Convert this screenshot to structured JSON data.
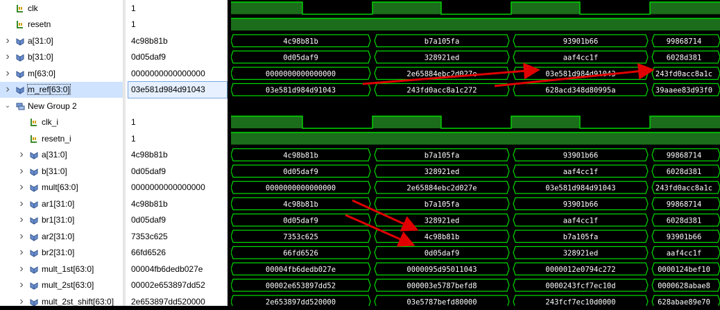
{
  "signals": [
    {
      "name": "clk",
      "value": "1",
      "kind": "bit",
      "indent": 0,
      "expand": ""
    },
    {
      "name": "resetn",
      "value": "1",
      "kind": "bit",
      "indent": 0,
      "expand": ""
    },
    {
      "name": "a[31:0]",
      "value": "4c98b81b",
      "kind": "bus",
      "indent": 0,
      "expand": ">",
      "segments": [
        "4c98b81b",
        "b7a105fa",
        "93901b66",
        "99868714"
      ]
    },
    {
      "name": "b[31:0]",
      "value": "0d05daf9",
      "kind": "bus",
      "indent": 0,
      "expand": ">",
      "segments": [
        "0d05daf9",
        "328921ed",
        "aaf4cc1f",
        "6028d381"
      ]
    },
    {
      "name": "m[63:0]",
      "value": "0000000000000000",
      "kind": "bus",
      "indent": 0,
      "expand": ">",
      "segments": [
        "0000000000000000",
        "2e65884ebc2d027e",
        "03e581d984d91043",
        "243fd0acc8a1c"
      ]
    },
    {
      "name": "m_ref[63:0]",
      "value": "03e581d984d91043",
      "kind": "bus",
      "indent": 0,
      "expand": ">",
      "selected": true,
      "segments": [
        "03e581d984d91043",
        "243fd0acc8a1c272",
        "628acd348d80995a",
        "39aaee83d93f0"
      ]
    },
    {
      "name": "New Group 2",
      "value": "",
      "kind": "group",
      "indent": 0,
      "expand": "v"
    },
    {
      "name": "clk_i",
      "value": "1",
      "kind": "bit",
      "indent": 1,
      "expand": ""
    },
    {
      "name": "resetn_i",
      "value": "1",
      "kind": "bit",
      "indent": 1,
      "expand": ""
    },
    {
      "name": "a[31:0]",
      "value": "4c98b81b",
      "kind": "bus",
      "indent": 1,
      "expand": ">",
      "segments": [
        "4c98b81b",
        "b7a105fa",
        "93901b66",
        "99868714"
      ]
    },
    {
      "name": "b[31:0]",
      "value": "0d05daf9",
      "kind": "bus",
      "indent": 1,
      "expand": ">",
      "segments": [
        "0d05daf9",
        "328921ed",
        "aaf4cc1f",
        "6028d381"
      ]
    },
    {
      "name": "mult[63:0]",
      "value": "0000000000000000",
      "kind": "bus",
      "indent": 1,
      "expand": ">",
      "segments": [
        "0000000000000000",
        "2e65884ebc2d027e",
        "03e581d984d91043",
        "243fd0acc8a1c"
      ]
    },
    {
      "name": "ar1[31:0]",
      "value": "4c98b81b",
      "kind": "bus",
      "indent": 1,
      "expand": ">",
      "segments": [
        "4c98b81b",
        "b7a105fa",
        "93901b66",
        "99868714"
      ]
    },
    {
      "name": "br1[31:0]",
      "value": "0d05daf9",
      "kind": "bus",
      "indent": 1,
      "expand": ">",
      "segments": [
        "0d05daf9",
        "328921ed",
        "aaf4cc1f",
        "6028d381"
      ]
    },
    {
      "name": "ar2[31:0]",
      "value": "7353c625",
      "kind": "bus",
      "indent": 1,
      "expand": ">",
      "segments": [
        "7353c625",
        "4c98b81b",
        "b7a105fa",
        "93901b66"
      ]
    },
    {
      "name": "br2[31:0]",
      "value": "66fd6526",
      "kind": "bus",
      "indent": 1,
      "expand": ">",
      "segments": [
        "66fd6526",
        "0d05daf9",
        "328921ed",
        "aaf4cc1f"
      ]
    },
    {
      "name": "mult_1st[63:0]",
      "value": "00004fb6dedb027e",
      "kind": "bus",
      "indent": 1,
      "expand": ">",
      "segments": [
        "00004fb6dedb027e",
        "0000095d95011043",
        "0000012e0794c272",
        "0000124bef10"
      ]
    },
    {
      "name": "mult_2st[63:0]",
      "value": "00002e653897dd52",
      "kind": "bus",
      "indent": 1,
      "expand": ">",
      "segments": [
        "00002e653897dd52",
        "000003e5787befd8",
        "0000243fcf7ec10d",
        "0000628abae8"
      ]
    },
    {
      "name": "mult_2st_shift[63:0]",
      "value": "2e653897dd520000",
      "kind": "bus",
      "indent": 1,
      "expand": ">",
      "segments": [
        "2e653897dd520000",
        "03e5787befd80000",
        "243fcf7ec10d0000",
        "628abae89e70"
      ]
    }
  ],
  "colors": {
    "wave": "#00d800",
    "bus_fill": "#0b3a0b",
    "clk_fill": "#1b6d1b",
    "arrow": "#e00000"
  }
}
